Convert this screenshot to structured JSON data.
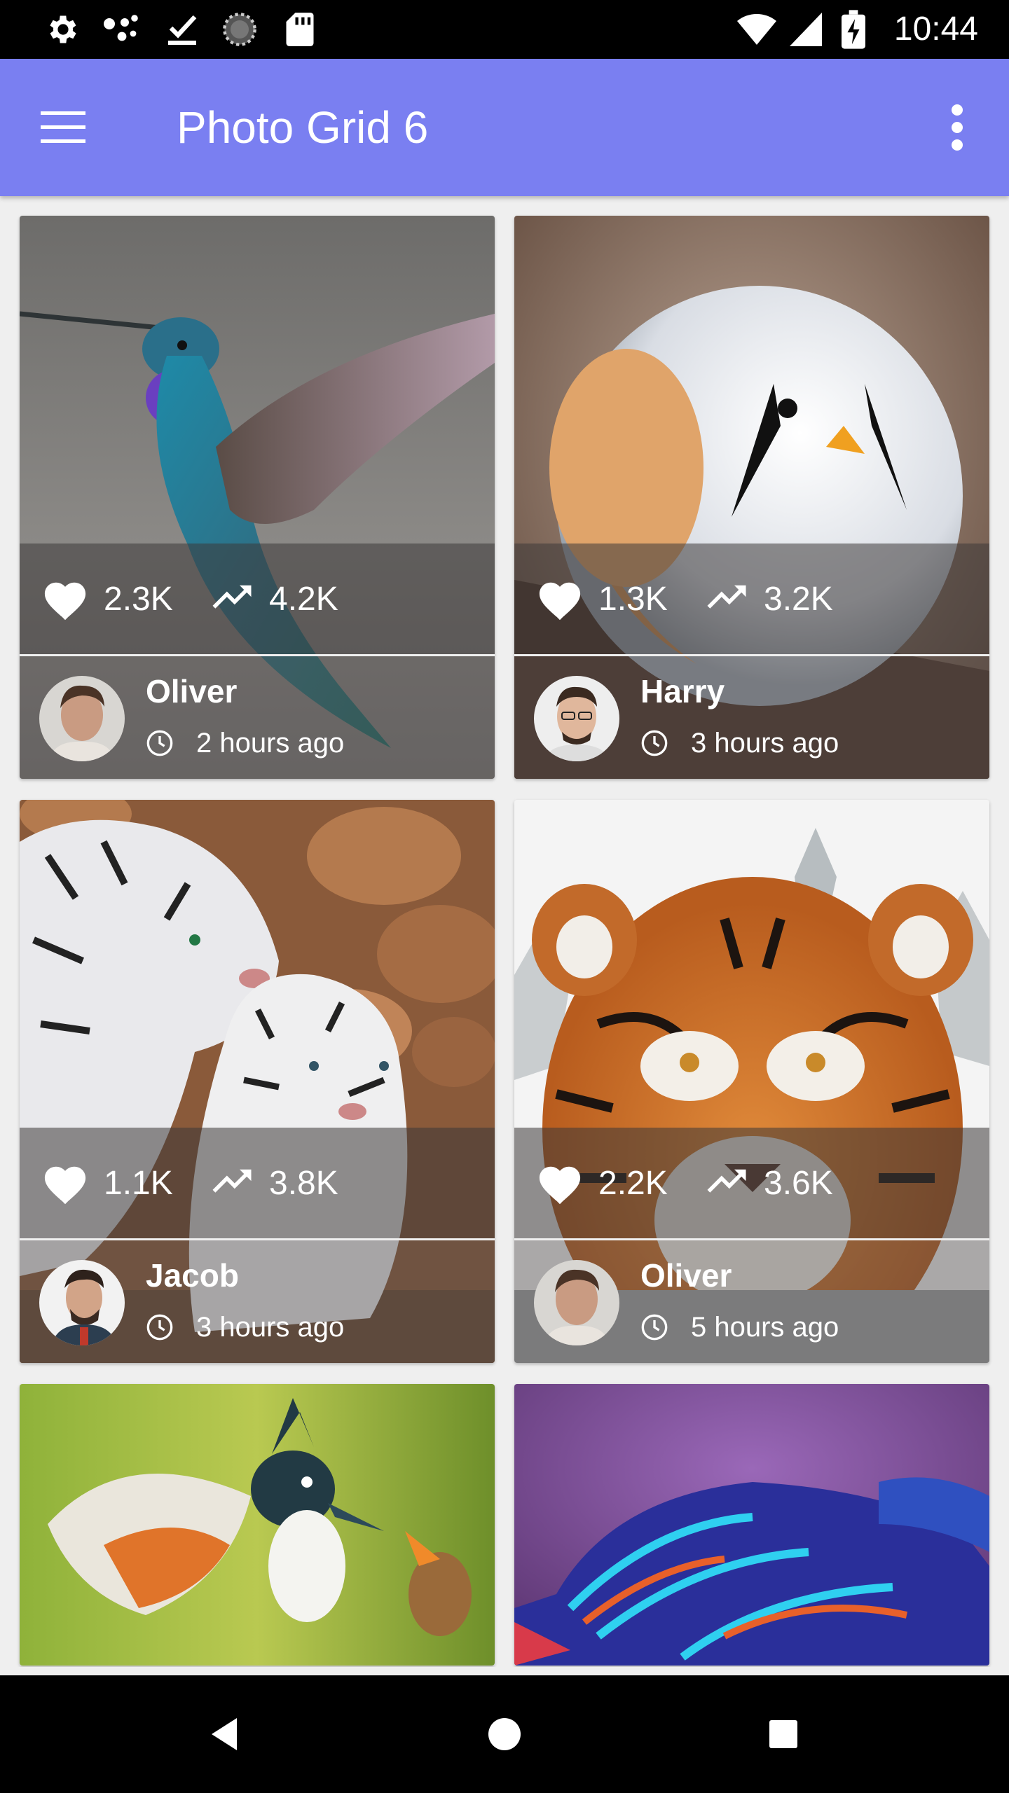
{
  "status_bar": {
    "time": "10:44",
    "left_icons": [
      "gear-icon",
      "dots-icon",
      "download-done-icon",
      "spinner-icon",
      "sd-card-icon"
    ],
    "right_icons": [
      "wifi-icon",
      "signal-icon",
      "battery-charging-icon"
    ]
  },
  "app_bar": {
    "title": "Photo Grid 6",
    "menu_icon": "hamburger-menu-icon",
    "more_icon": "more-vertical-icon",
    "color": "#7a7ff1"
  },
  "cards": [
    {
      "likes": "2.3K",
      "trend": "4.2K",
      "author": "Oliver",
      "time": "2 hours ago",
      "photo": "hummingbird"
    },
    {
      "likes": "1.3K",
      "trend": "3.2K",
      "author": "Harry",
      "time": "3 hours ago",
      "photo": "round bird"
    },
    {
      "likes": "1.1K",
      "trend": "3.8K",
      "author": "Jacob",
      "time": "3 hours ago",
      "photo": "white tigers"
    },
    {
      "likes": "2.2K",
      "trend": "3.6K",
      "author": "Oliver",
      "time": "5 hours ago",
      "photo": "tiger in snow"
    },
    {
      "photo": "exotic bird feeding chick"
    },
    {
      "photo": "mandarin fish"
    }
  ],
  "nav_bar": {
    "icons": [
      "back-icon",
      "home-icon",
      "recents-icon"
    ]
  }
}
